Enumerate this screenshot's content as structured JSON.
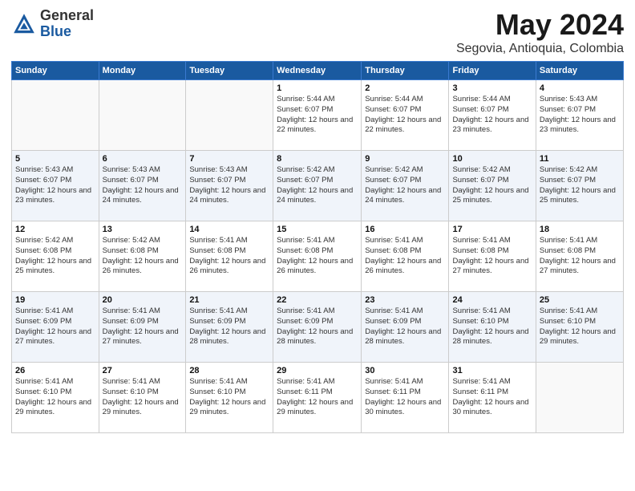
{
  "header": {
    "logo_general": "General",
    "logo_blue": "Blue",
    "title": "May 2024",
    "subtitle": "Segovia, Antioquia, Colombia"
  },
  "days_of_week": [
    "Sunday",
    "Monday",
    "Tuesday",
    "Wednesday",
    "Thursday",
    "Friday",
    "Saturday"
  ],
  "weeks": [
    [
      {
        "day": "",
        "info": ""
      },
      {
        "day": "",
        "info": ""
      },
      {
        "day": "",
        "info": ""
      },
      {
        "day": "1",
        "info": "Sunrise: 5:44 AM\nSunset: 6:07 PM\nDaylight: 12 hours\nand 22 minutes."
      },
      {
        "day": "2",
        "info": "Sunrise: 5:44 AM\nSunset: 6:07 PM\nDaylight: 12 hours\nand 22 minutes."
      },
      {
        "day": "3",
        "info": "Sunrise: 5:44 AM\nSunset: 6:07 PM\nDaylight: 12 hours\nand 23 minutes."
      },
      {
        "day": "4",
        "info": "Sunrise: 5:43 AM\nSunset: 6:07 PM\nDaylight: 12 hours\nand 23 minutes."
      }
    ],
    [
      {
        "day": "5",
        "info": "Sunrise: 5:43 AM\nSunset: 6:07 PM\nDaylight: 12 hours\nand 23 minutes."
      },
      {
        "day": "6",
        "info": "Sunrise: 5:43 AM\nSunset: 6:07 PM\nDaylight: 12 hours\nand 24 minutes."
      },
      {
        "day": "7",
        "info": "Sunrise: 5:43 AM\nSunset: 6:07 PM\nDaylight: 12 hours\nand 24 minutes."
      },
      {
        "day": "8",
        "info": "Sunrise: 5:42 AM\nSunset: 6:07 PM\nDaylight: 12 hours\nand 24 minutes."
      },
      {
        "day": "9",
        "info": "Sunrise: 5:42 AM\nSunset: 6:07 PM\nDaylight: 12 hours\nand 24 minutes."
      },
      {
        "day": "10",
        "info": "Sunrise: 5:42 AM\nSunset: 6:07 PM\nDaylight: 12 hours\nand 25 minutes."
      },
      {
        "day": "11",
        "info": "Sunrise: 5:42 AM\nSunset: 6:07 PM\nDaylight: 12 hours\nand 25 minutes."
      }
    ],
    [
      {
        "day": "12",
        "info": "Sunrise: 5:42 AM\nSunset: 6:08 PM\nDaylight: 12 hours\nand 25 minutes."
      },
      {
        "day": "13",
        "info": "Sunrise: 5:42 AM\nSunset: 6:08 PM\nDaylight: 12 hours\nand 26 minutes."
      },
      {
        "day": "14",
        "info": "Sunrise: 5:41 AM\nSunset: 6:08 PM\nDaylight: 12 hours\nand 26 minutes."
      },
      {
        "day": "15",
        "info": "Sunrise: 5:41 AM\nSunset: 6:08 PM\nDaylight: 12 hours\nand 26 minutes."
      },
      {
        "day": "16",
        "info": "Sunrise: 5:41 AM\nSunset: 6:08 PM\nDaylight: 12 hours\nand 26 minutes."
      },
      {
        "day": "17",
        "info": "Sunrise: 5:41 AM\nSunset: 6:08 PM\nDaylight: 12 hours\nand 27 minutes."
      },
      {
        "day": "18",
        "info": "Sunrise: 5:41 AM\nSunset: 6:08 PM\nDaylight: 12 hours\nand 27 minutes."
      }
    ],
    [
      {
        "day": "19",
        "info": "Sunrise: 5:41 AM\nSunset: 6:09 PM\nDaylight: 12 hours\nand 27 minutes."
      },
      {
        "day": "20",
        "info": "Sunrise: 5:41 AM\nSunset: 6:09 PM\nDaylight: 12 hours\nand 27 minutes."
      },
      {
        "day": "21",
        "info": "Sunrise: 5:41 AM\nSunset: 6:09 PM\nDaylight: 12 hours\nand 28 minutes."
      },
      {
        "day": "22",
        "info": "Sunrise: 5:41 AM\nSunset: 6:09 PM\nDaylight: 12 hours\nand 28 minutes."
      },
      {
        "day": "23",
        "info": "Sunrise: 5:41 AM\nSunset: 6:09 PM\nDaylight: 12 hours\nand 28 minutes."
      },
      {
        "day": "24",
        "info": "Sunrise: 5:41 AM\nSunset: 6:10 PM\nDaylight: 12 hours\nand 28 minutes."
      },
      {
        "day": "25",
        "info": "Sunrise: 5:41 AM\nSunset: 6:10 PM\nDaylight: 12 hours\nand 29 minutes."
      }
    ],
    [
      {
        "day": "26",
        "info": "Sunrise: 5:41 AM\nSunset: 6:10 PM\nDaylight: 12 hours\nand 29 minutes."
      },
      {
        "day": "27",
        "info": "Sunrise: 5:41 AM\nSunset: 6:10 PM\nDaylight: 12 hours\nand 29 minutes."
      },
      {
        "day": "28",
        "info": "Sunrise: 5:41 AM\nSunset: 6:10 PM\nDaylight: 12 hours\nand 29 minutes."
      },
      {
        "day": "29",
        "info": "Sunrise: 5:41 AM\nSunset: 6:11 PM\nDaylight: 12 hours\nand 29 minutes."
      },
      {
        "day": "30",
        "info": "Sunrise: 5:41 AM\nSunset: 6:11 PM\nDaylight: 12 hours\nand 30 minutes."
      },
      {
        "day": "31",
        "info": "Sunrise: 5:41 AM\nSunset: 6:11 PM\nDaylight: 12 hours\nand 30 minutes."
      },
      {
        "day": "",
        "info": ""
      }
    ]
  ]
}
